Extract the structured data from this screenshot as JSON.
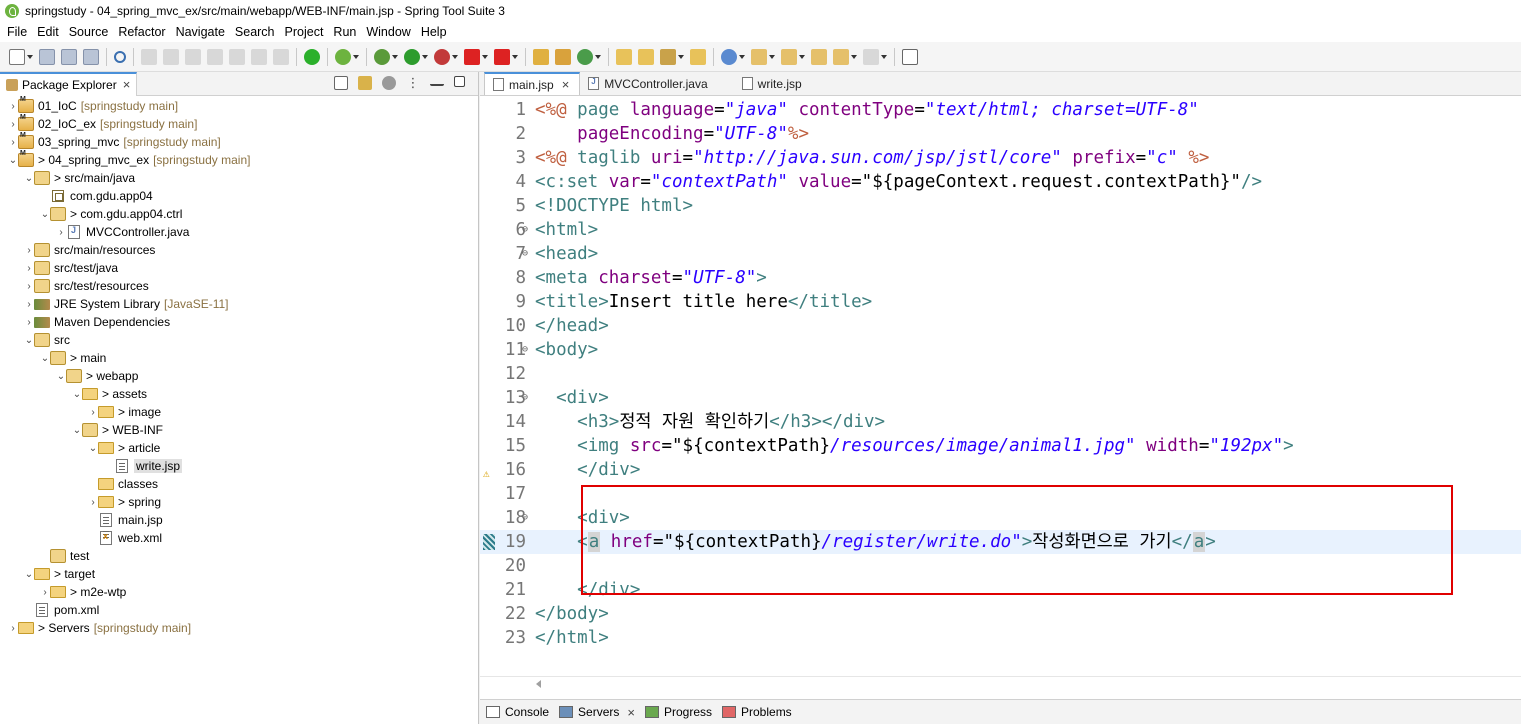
{
  "window": {
    "title": "springstudy - 04_spring_mvc_ex/src/main/webapp/WEB-INF/main.jsp - Spring Tool Suite 3"
  },
  "menu": [
    "File",
    "Edit",
    "Source",
    "Refactor",
    "Navigate",
    "Search",
    "Project",
    "Run",
    "Window",
    "Help"
  ],
  "package_explorer": {
    "tab_label": "Package Explorer",
    "tree": [
      {
        "label": "01_IoC",
        "decoration": "[springstudy main]"
      },
      {
        "label": "02_IoC_ex",
        "decoration": "[springstudy main]"
      },
      {
        "label": "03_spring_mvc",
        "decoration": "[springstudy main]"
      },
      {
        "label": "> 04_spring_mvc_ex",
        "decoration": "[springstudy main]"
      },
      {
        "label": "> src/main/java",
        "decoration": ""
      },
      {
        "label": "com.gdu.app04",
        "decoration": ""
      },
      {
        "label": "> com.gdu.app04.ctrl",
        "decoration": ""
      },
      {
        "label": "MVCController.java",
        "decoration": ""
      },
      {
        "label": "src/main/resources",
        "decoration": ""
      },
      {
        "label": "src/test/java",
        "decoration": ""
      },
      {
        "label": "src/test/resources",
        "decoration": ""
      },
      {
        "label": "JRE System Library",
        "decoration": "[JavaSE-11]"
      },
      {
        "label": "Maven Dependencies",
        "decoration": ""
      },
      {
        "label": "src",
        "decoration": ""
      },
      {
        "label": "> main",
        "decoration": ""
      },
      {
        "label": "> webapp",
        "decoration": ""
      },
      {
        "label": "> assets",
        "decoration": ""
      },
      {
        "label": "> image",
        "decoration": ""
      },
      {
        "label": "> WEB-INF",
        "decoration": ""
      },
      {
        "label": "> article",
        "decoration": ""
      },
      {
        "label": "write.jsp",
        "decoration": ""
      },
      {
        "label": "classes",
        "decoration": ""
      },
      {
        "label": "> spring",
        "decoration": ""
      },
      {
        "label": "main.jsp",
        "decoration": ""
      },
      {
        "label": "web.xml",
        "decoration": ""
      },
      {
        "label": "test",
        "decoration": ""
      },
      {
        "label": "> target",
        "decoration": ""
      },
      {
        "label": "> m2e-wtp",
        "decoration": ""
      },
      {
        "label": "pom.xml",
        "decoration": ""
      },
      {
        "label": "> Servers",
        "decoration": "[springstudy main]"
      }
    ]
  },
  "editor": {
    "tabs": [
      "main.jsp",
      "MVCController.java",
      "write.jsp"
    ],
    "line_numbers": [
      "1",
      "2",
      "3",
      "4",
      "5",
      "6",
      "7",
      "8",
      "9",
      "10",
      "11",
      "12",
      "13",
      "14",
      "15",
      "16",
      "17",
      "18",
      "19",
      "20",
      "21",
      "22",
      "23"
    ],
    "lines": [
      {
        "p": [
          [
            "dir",
            "<%@ "
          ],
          [
            "kw",
            "page "
          ],
          [
            "an",
            "language"
          ],
          [
            "str",
            "="
          ],
          [
            "av",
            "\"java\""
          ],
          [
            "txt",
            " "
          ],
          [
            "an",
            "contentType"
          ],
          [
            "str",
            "="
          ],
          [
            "av",
            "\"text/html; charset=UTF-8\""
          ]
        ]
      },
      {
        "p": [
          [
            "txt",
            "    "
          ],
          [
            "an",
            "pageEncoding"
          ],
          [
            "str",
            "="
          ],
          [
            "av",
            "\"UTF-8\""
          ],
          [
            "dir",
            "%>"
          ]
        ]
      },
      {
        "p": [
          [
            "dir",
            "<%@ "
          ],
          [
            "kw",
            "taglib "
          ],
          [
            "an",
            "uri"
          ],
          [
            "str",
            "="
          ],
          [
            "av",
            "\"http://java.sun.com/jsp/jstl/core\""
          ],
          [
            "txt",
            " "
          ],
          [
            "an",
            "prefix"
          ],
          [
            "str",
            "="
          ],
          [
            "av",
            "\"c\""
          ],
          [
            "txt",
            " "
          ],
          [
            "dir",
            "%>"
          ]
        ]
      },
      {
        "p": [
          [
            "tag",
            "<c:set "
          ],
          [
            "an",
            "var"
          ],
          [
            "str",
            "="
          ],
          [
            "av",
            "\"contextPath\""
          ],
          [
            "txt",
            " "
          ],
          [
            "an",
            "value"
          ],
          [
            "str",
            "="
          ],
          [
            "txt",
            "\"${pageContext.request.contextPath}\""
          ],
          [
            "tag",
            "/>"
          ]
        ]
      },
      {
        "p": [
          [
            "tag",
            "<!DOCTYPE html>"
          ]
        ]
      },
      {
        "p": [
          [
            "tag",
            "<html>"
          ]
        ]
      },
      {
        "p": [
          [
            "tag",
            "<head>"
          ]
        ]
      },
      {
        "p": [
          [
            "tag",
            "<meta "
          ],
          [
            "an",
            "charset"
          ],
          [
            "str",
            "="
          ],
          [
            "av",
            "\"UTF-8\""
          ],
          [
            "tag",
            ">"
          ]
        ]
      },
      {
        "p": [
          [
            "tag",
            "<title>"
          ],
          [
            "txt",
            "Insert title here"
          ],
          [
            "tag",
            "</title>"
          ]
        ]
      },
      {
        "p": [
          [
            "tag",
            "</head>"
          ]
        ]
      },
      {
        "p": [
          [
            "tag",
            "<body>"
          ]
        ]
      },
      {
        "p": []
      },
      {
        "p": [
          [
            "txt",
            "  "
          ],
          [
            "tag",
            "<div>"
          ]
        ]
      },
      {
        "p": [
          [
            "txt",
            "    "
          ],
          [
            "tag",
            "<h3>"
          ],
          [
            "txt",
            "정적 자원 확인하기"
          ],
          [
            "tag",
            "</h3></div>"
          ]
        ]
      },
      {
        "p": [
          [
            "txt",
            "    "
          ],
          [
            "tag",
            "<img "
          ],
          [
            "an",
            "src"
          ],
          [
            "str",
            "="
          ],
          [
            "txt",
            "\"${contextPath}"
          ],
          [
            "av",
            "/resources/image/animal1.jpg\""
          ],
          [
            "txt",
            " "
          ],
          [
            "an",
            "width"
          ],
          [
            "str",
            "="
          ],
          [
            "av",
            "\"192px\""
          ],
          [
            "tag",
            ">"
          ]
        ]
      },
      {
        "p": [
          [
            "txt",
            "    "
          ],
          [
            "tag",
            "</div>"
          ]
        ]
      },
      {
        "p": []
      },
      {
        "p": [
          [
            "txt",
            "    "
          ],
          [
            "tag",
            "<div>"
          ]
        ]
      },
      {
        "p": [
          [
            "txt",
            "    "
          ],
          [
            "tag",
            "<"
          ],
          [
            "box",
            "a"
          ],
          [
            "txt",
            " "
          ],
          [
            "an",
            "href"
          ],
          [
            "str",
            "="
          ],
          [
            "txt",
            "\"${contextPath}"
          ],
          [
            "av",
            "/register/write.do\""
          ],
          [
            "tag",
            ">"
          ],
          [
            "txt",
            "작성화면으로 가기"
          ],
          [
            "tag",
            "</"
          ],
          [
            "box",
            "a"
          ],
          [
            "tag",
            ">"
          ]
        ]
      },
      {
        "p": []
      },
      {
        "p": [
          [
            "txt",
            "    "
          ],
          [
            "tag",
            "</div>"
          ]
        ]
      },
      {
        "p": [
          [
            "tag",
            "</body>"
          ]
        ]
      },
      {
        "p": [
          [
            "tag",
            "</html>"
          ]
        ]
      }
    ]
  },
  "bottom_tabs": [
    "Console",
    "Servers",
    "Progress",
    "Problems"
  ],
  "colors": {
    "tag": "#3f7f7f",
    "attr": "#7f007f",
    "value": "#2a00ff",
    "directive": "#bf5f3f",
    "highlight_line": "#e8f2fe",
    "annotation_box": "#e00000"
  }
}
